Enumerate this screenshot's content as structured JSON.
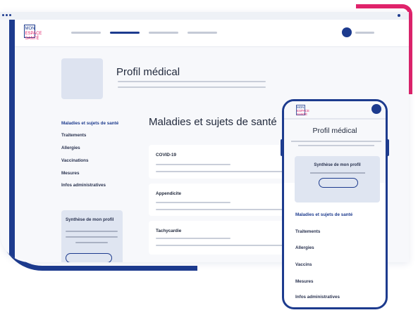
{
  "logo": {
    "line1": "MON",
    "line2": "ESPACE",
    "line3": "SANTÉ"
  },
  "profile": {
    "title": "Profil médical"
  },
  "sidebar": {
    "items": [
      {
        "label": "Maladies et sujets de santé"
      },
      {
        "label": "Traitements"
      },
      {
        "label": "Allergies"
      },
      {
        "label": "Vaccinations"
      },
      {
        "label": "Mesures"
      },
      {
        "label": "Infos administratives"
      }
    ],
    "synthesis_title": "Synthèse de mon profil"
  },
  "main": {
    "section_title": "Maladies et sujets de santé",
    "cards": [
      {
        "title": "COVID-19"
      },
      {
        "title": "Appendicite"
      },
      {
        "title": "Tachycardie"
      }
    ]
  },
  "mobile": {
    "title": "Profil médical",
    "synthesis_title": "Synthèse de mon profil",
    "items": [
      {
        "label": "Maladies et sujets de santé"
      },
      {
        "label": "Traitements"
      },
      {
        "label": "Allergies"
      },
      {
        "label": "Vaccins"
      },
      {
        "label": "Mesures"
      },
      {
        "label": "Infos administratives"
      }
    ]
  },
  "colors": {
    "navy": "#1d3b8e",
    "pink": "#e0236b",
    "placeholder": "#c5cad6",
    "card": "#dfe5f1"
  }
}
